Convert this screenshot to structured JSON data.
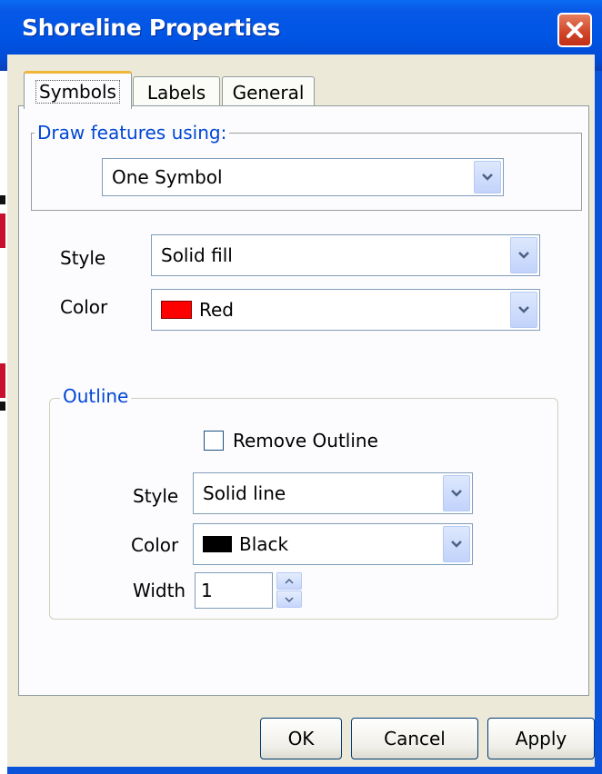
{
  "window": {
    "title": "Shoreline Properties"
  },
  "tabs": [
    {
      "label": "Symbols",
      "active": true
    },
    {
      "label": "Labels",
      "active": false
    },
    {
      "label": "General",
      "active": false
    }
  ],
  "draw_features": {
    "legend": "Draw features using:",
    "selected": "One Symbol"
  },
  "fill": {
    "style_label": "Style",
    "style_value": "Solid fill",
    "color_label": "Color",
    "color_value": "Red",
    "color_hex": "#ff0000"
  },
  "outline": {
    "legend": "Outline",
    "remove_label": "Remove Outline",
    "remove_checked": false,
    "style_label": "Style",
    "style_value": "Solid line",
    "color_label": "Color",
    "color_value": "Black",
    "color_hex": "#000000",
    "width_label": "Width",
    "width_value": "1"
  },
  "buttons": {
    "ok": "OK",
    "cancel": "Cancel",
    "apply": "Apply"
  }
}
